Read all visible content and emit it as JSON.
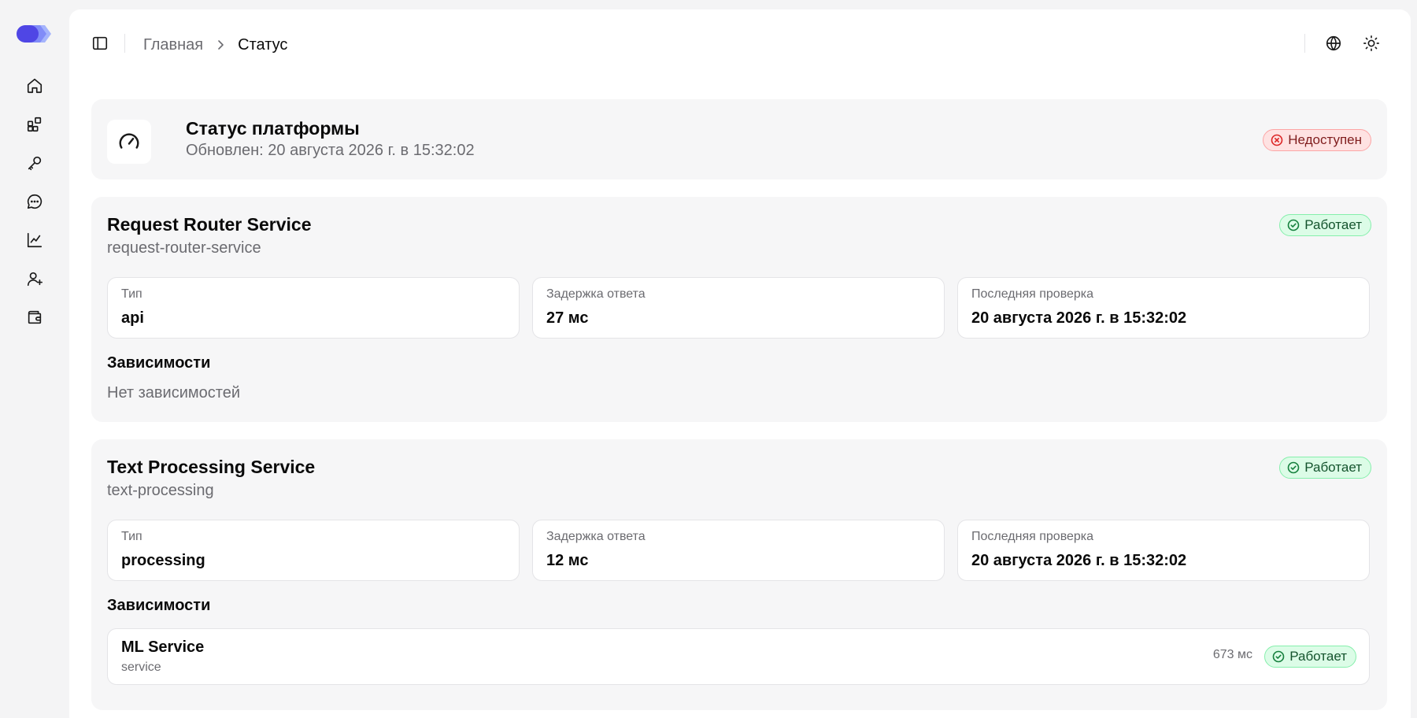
{
  "icons": {
    "logo": "logo",
    "nav": [
      "home-icon",
      "apps-icon",
      "key-icon",
      "chat-icon",
      "chart-icon",
      "user-plus-icon",
      "wallet-icon"
    ],
    "sidebar_toggle": "sidebar-toggle-icon",
    "language": "globe-icon",
    "theme": "sun-icon",
    "platform": "gauge-icon"
  },
  "colors": {
    "brand": "#4f46e5",
    "ok_bg": "#dcfce7",
    "ok_text": "#14532d",
    "err_bg": "#fee2e2",
    "err_text": "#7f1d1d"
  },
  "breadcrumb": {
    "home": "Главная",
    "current": "Статус"
  },
  "platform": {
    "title": "Статус платформы",
    "updated": "Обновлен: 20 августа 2026 г. в 15:32:02",
    "status": "Недоступен"
  },
  "services": [
    {
      "name": "Request Router Service",
      "id": "request-router-service",
      "status": "Работает",
      "metrics": [
        {
          "label": "Тип",
          "value": "api"
        },
        {
          "label": "Задержка ответа",
          "value": "27 мс"
        },
        {
          "label": "Последняя проверка",
          "value": "20 августа 2026 г. в 15:32:02"
        }
      ],
      "deps_label": "Зависимости",
      "deps_empty": "Нет зависимостей"
    },
    {
      "name": "Text Processing Service",
      "id": "text-processing",
      "status": "Работает",
      "metrics": [
        {
          "label": "Тип",
          "value": "processing"
        },
        {
          "label": "Задержка ответа",
          "value": "12 мс"
        },
        {
          "label": "Последняя проверка",
          "value": "20 августа 2026 г. в 15:32:02"
        }
      ],
      "deps_label": "Зависимости",
      "deps": [
        {
          "name": "ML Service",
          "type": "service",
          "latency": "673 мс",
          "status": "Работает"
        }
      ]
    }
  ]
}
